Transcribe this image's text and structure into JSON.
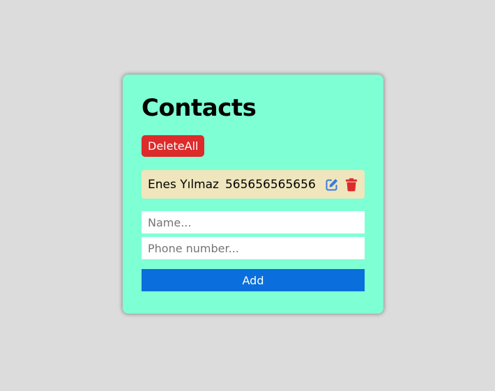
{
  "page": {
    "background_color": "#dcdcdc"
  },
  "card": {
    "title": "Contacts",
    "background_color": "#7fffd4",
    "delete_all_label": "DeleteAll",
    "delete_all_color": "#dd2a2a"
  },
  "contacts": [
    {
      "name": "Enes Yılmaz",
      "phone": "565656565656",
      "row_color": "#efe6bd",
      "edit_icon": "edit-icon",
      "delete_icon": "trash-icon"
    }
  ],
  "form": {
    "name_placeholder": "Name...",
    "name_value": "",
    "phone_placeholder": "Phone number...",
    "phone_value": "",
    "add_label": "Add",
    "add_color": "#0a6fdc"
  },
  "colors": {
    "edit_icon": "#3a7be0",
    "delete_icon": "#dd2a2a"
  }
}
